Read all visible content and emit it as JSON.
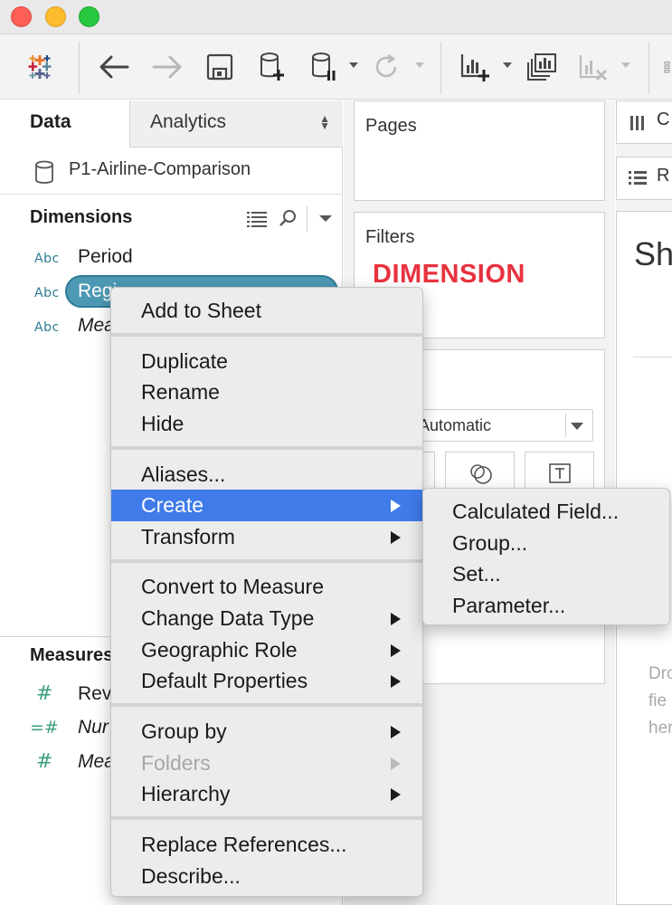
{
  "toolbar": {
    "icons": [
      "tableau-logo-icon",
      "back-arrow-icon",
      "forward-arrow-icon",
      "save-icon",
      "new-datasource-icon",
      "pause-updates-icon",
      "refresh-icon",
      "new-worksheet-icon",
      "duplicate-sheet-icon",
      "clear-sheet-icon"
    ]
  },
  "data_pane": {
    "tab_data": "Data",
    "tab_analytics": "Analytics",
    "datasource": "P1-Airline-Comparison",
    "dimensions_title": "Dimensions",
    "dimensions": [
      {
        "badge": "Abc",
        "name": "Period"
      },
      {
        "badge": "Abc",
        "name": "Regi"
      },
      {
        "badge": "Abc",
        "name": "Mea"
      }
    ],
    "measures_title": "Measures",
    "measures": [
      {
        "badge": "#",
        "name": "Reve"
      },
      {
        "badge": "=#",
        "name": "Nur"
      },
      {
        "badge": "#",
        "name": "Mea"
      }
    ]
  },
  "shelves": {
    "pages_title": "Pages",
    "filters_title": "Filters",
    "filters_drop_label": "DIMENSION",
    "marks_type": "Automatic",
    "columns_label": "C",
    "rows_label": "R"
  },
  "sheet": {
    "title": "Sh",
    "drop_hint_lines": [
      "Dro",
      "fie",
      "her"
    ]
  },
  "context_menu": {
    "items": [
      {
        "label": "Add to Sheet"
      },
      {
        "label": "Duplicate"
      },
      {
        "label": "Rename"
      },
      {
        "label": "Hide"
      },
      {
        "label": "Aliases..."
      },
      {
        "label": "Create"
      },
      {
        "label": "Transform"
      },
      {
        "label": "Convert to Measure"
      },
      {
        "label": "Change Data Type"
      },
      {
        "label": "Geographic Role"
      },
      {
        "label": "Default Properties"
      },
      {
        "label": "Group by"
      },
      {
        "label": "Folders"
      },
      {
        "label": "Hierarchy"
      },
      {
        "label": "Replace References..."
      },
      {
        "label": "Describe..."
      }
    ],
    "active_item": "Create",
    "disabled_item": "Folders"
  },
  "create_submenu": {
    "items": [
      {
        "label": "Calculated Field..."
      },
      {
        "label": "Group..."
      },
      {
        "label": "Set..."
      },
      {
        "label": "Parameter..."
      }
    ]
  },
  "colors": {
    "menu_highlight": "#3f7be9",
    "dimension_badge": "#2c7b92",
    "measure_badge": "#3ea07e",
    "selected_pill": "#4d99b4",
    "filters_label": "#e8323f"
  }
}
